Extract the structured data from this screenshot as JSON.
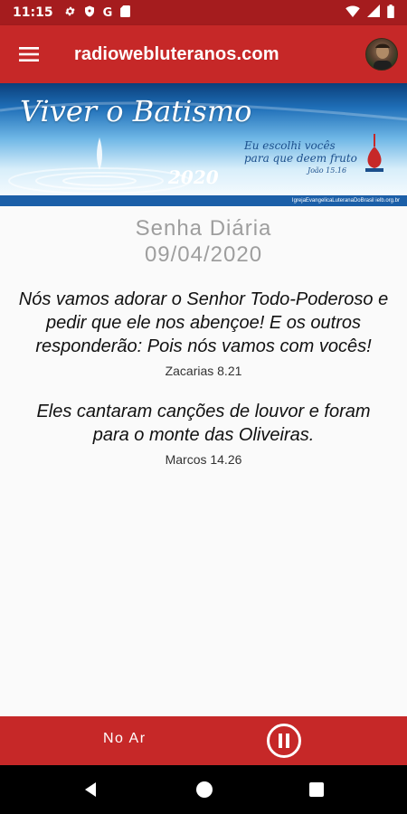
{
  "status_bar": {
    "time": "11:15",
    "left_icons": [
      "settings-icon",
      "shield-icon",
      "google-icon",
      "sd-card-icon"
    ],
    "google_glyph": "G",
    "right_icons": [
      "wifi-icon",
      "signal-icon",
      "battery-icon"
    ]
  },
  "app_bar": {
    "title": "radiowebluteranos.com",
    "menu_icon": "hamburger-menu-icon",
    "avatar_icon": "profile-avatar-icon",
    "background": "#c62828"
  },
  "banner": {
    "title": "Viver o Batismo",
    "year": "2020",
    "verse_line1": "Eu escolhi vocês",
    "verse_line2": "para que deem fruto",
    "verse_ref": "João 15.16",
    "footer": "IgrejaEvangelicaLuteranaDoBrasil   ielb.org.br"
  },
  "content": {
    "heading": "Senha Diária",
    "date": "09/04/2020",
    "verses": [
      {
        "text": "Nós vamos adorar o Senhor Todo-Poderoso e pedir que ele nos abençoe! E os outros responderão: Pois nós vamos com vocês!",
        "reference": "Zacarias 8.21"
      },
      {
        "text": "Eles cantaram canções de louvor e foram para o monte das Oliveiras.",
        "reference": "Marcos 14.26"
      }
    ]
  },
  "player": {
    "status": "No Ar",
    "pause_icon": "pause-circle-icon"
  },
  "nav_bar": {
    "icons": [
      "back-icon",
      "home-icon",
      "recents-icon"
    ]
  },
  "colors": {
    "primary": "#c62828",
    "status_bar": "#a51c1e",
    "heading_gray": "#9e9e9e"
  }
}
